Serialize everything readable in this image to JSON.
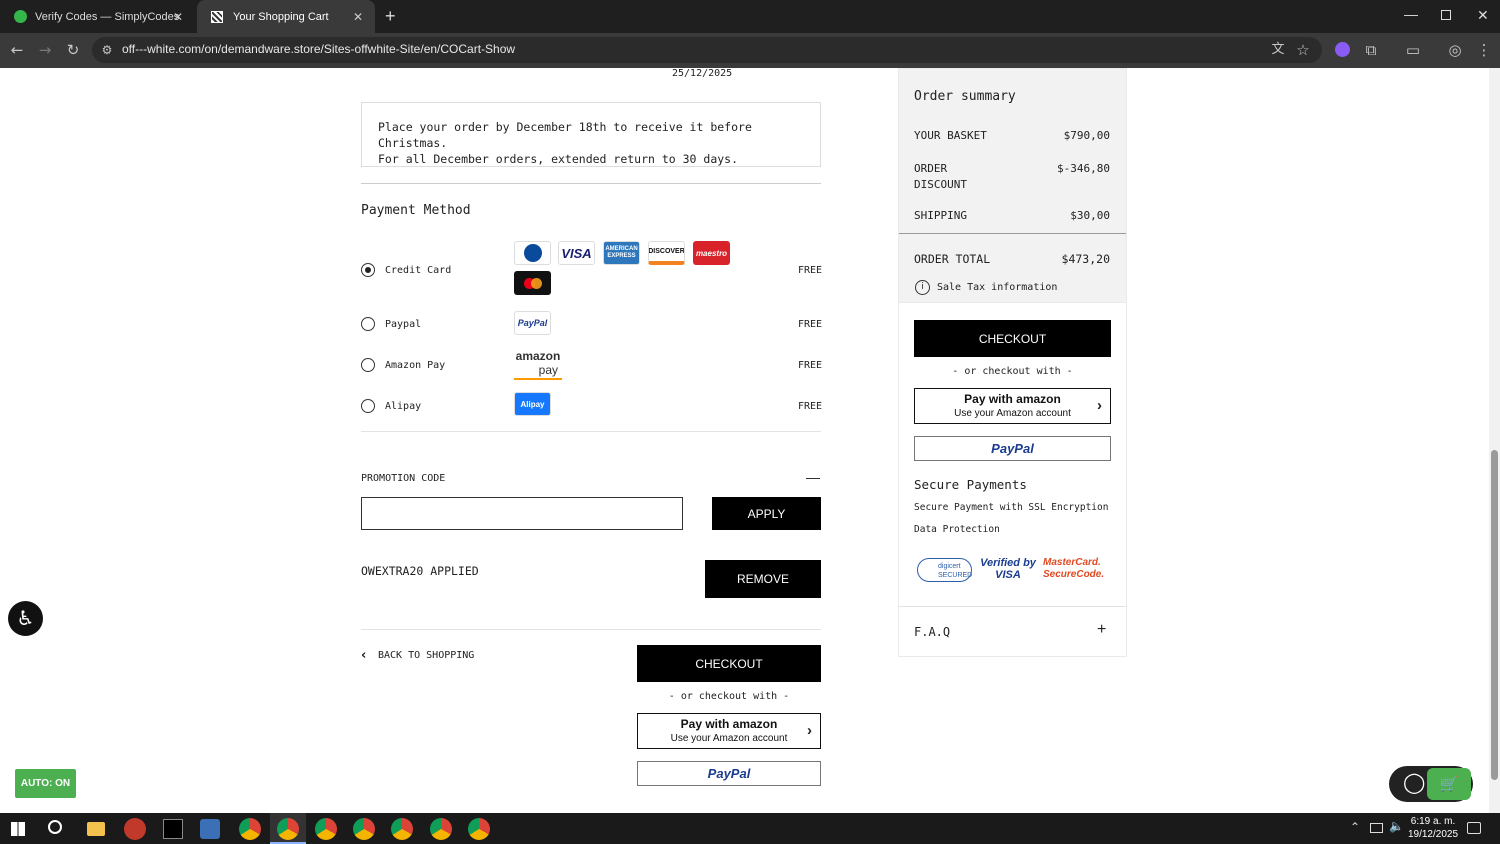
{
  "browser": {
    "tabs": [
      {
        "title": "Verify Codes — SimplyCodes"
      },
      {
        "title": "Your Shopping Cart"
      }
    ],
    "url": "off---white.com/on/demandware.store/Sites-offwhite-Site/en/COCart-Show"
  },
  "cart": {
    "delivery_date": "25/12/2025",
    "notice_line1": "Place your order by December 18th to receive it before Christmas.",
    "notice_line2": "For all December orders, extended return to 30 days.",
    "payment_title": "Payment Method",
    "payment_methods": [
      {
        "label": "Credit Card",
        "price": "FREE",
        "selected": true
      },
      {
        "label": "Paypal",
        "price": "FREE",
        "selected": false
      },
      {
        "label": "Amazon Pay",
        "price": "FREE",
        "selected": false
      },
      {
        "label": "Alipay",
        "price": "FREE",
        "selected": false
      }
    ],
    "card_logos": [
      "VISA",
      "DISCOVER",
      "maestro",
      "AMERICAN EXPRESS"
    ],
    "paypal_logo": "PayPal",
    "amazon_pay_logo": [
      "amazon",
      "pay"
    ],
    "alipay_logo": "Alipay",
    "promo_label": "PROMOTION CODE",
    "promo_toggle": "—",
    "promo_value": "",
    "apply_label": "APPLY",
    "applied_code": "OWEXTRA20 APPLIED",
    "remove_label": "REMOVE",
    "back_label": "BACK TO SHOPPING",
    "checkout_label": "CHECKOUT",
    "or_checkout": "- or checkout with -",
    "amazon_btn_line1": "Pay with amazon",
    "amazon_btn_line2": "Use your Amazon account",
    "paypal_btn": "PayPal"
  },
  "summary": {
    "title": "Order summary",
    "basket_label": "YOUR BASKET",
    "basket_value": "$790,00",
    "discount_label_1": "ORDER",
    "discount_label_2": "DISCOUNT",
    "discount_value": "$-346,80",
    "shipping_label": "SHIPPING",
    "shipping_value": "$30,00",
    "total_label": "ORDER TOTAL",
    "total_value": "$473,20",
    "tax_info": "Sale Tax information",
    "checkout_label": "CHECKOUT",
    "or_checkout": "- or checkout with -",
    "amazon_btn_line1": "Pay with amazon",
    "amazon_btn_line2": "Use your Amazon account",
    "paypal_btn": "PayPal",
    "secure_title": "Secure Payments",
    "secure_line1": "Secure Payment with SSL Encryption",
    "secure_line2": "Data Protection",
    "badges": [
      "digicert SECURED",
      "Verified by VISA",
      "MasterCard. SecureCode."
    ],
    "faq_label": "F.A.Q",
    "faq_toggle": "+"
  },
  "widgets": {
    "auto_badge": "AUTO: ON"
  },
  "system": {
    "time": "6:19 a. m.",
    "date": "19/12/2025"
  },
  "colors": {
    "accent_green": "#4caf50",
    "paypal_blue": "#1c3c8f",
    "amazon_orange": "#ff9900",
    "mastercard_red": "#eb001b"
  }
}
